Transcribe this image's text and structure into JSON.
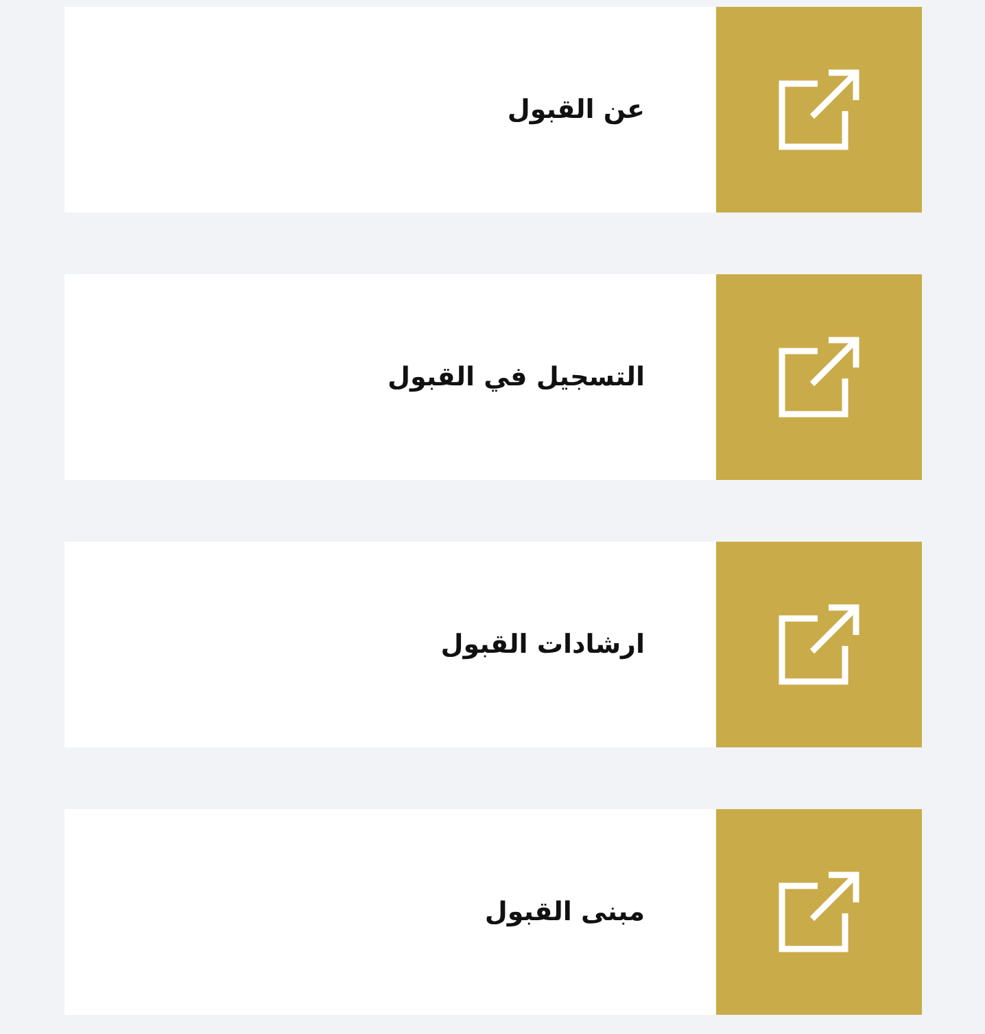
{
  "items": [
    {
      "label": "عن القبول"
    },
    {
      "label": "التسجيل في القبول"
    },
    {
      "label": "ارشادات القبول"
    },
    {
      "label": "مبنى القبول"
    }
  ]
}
